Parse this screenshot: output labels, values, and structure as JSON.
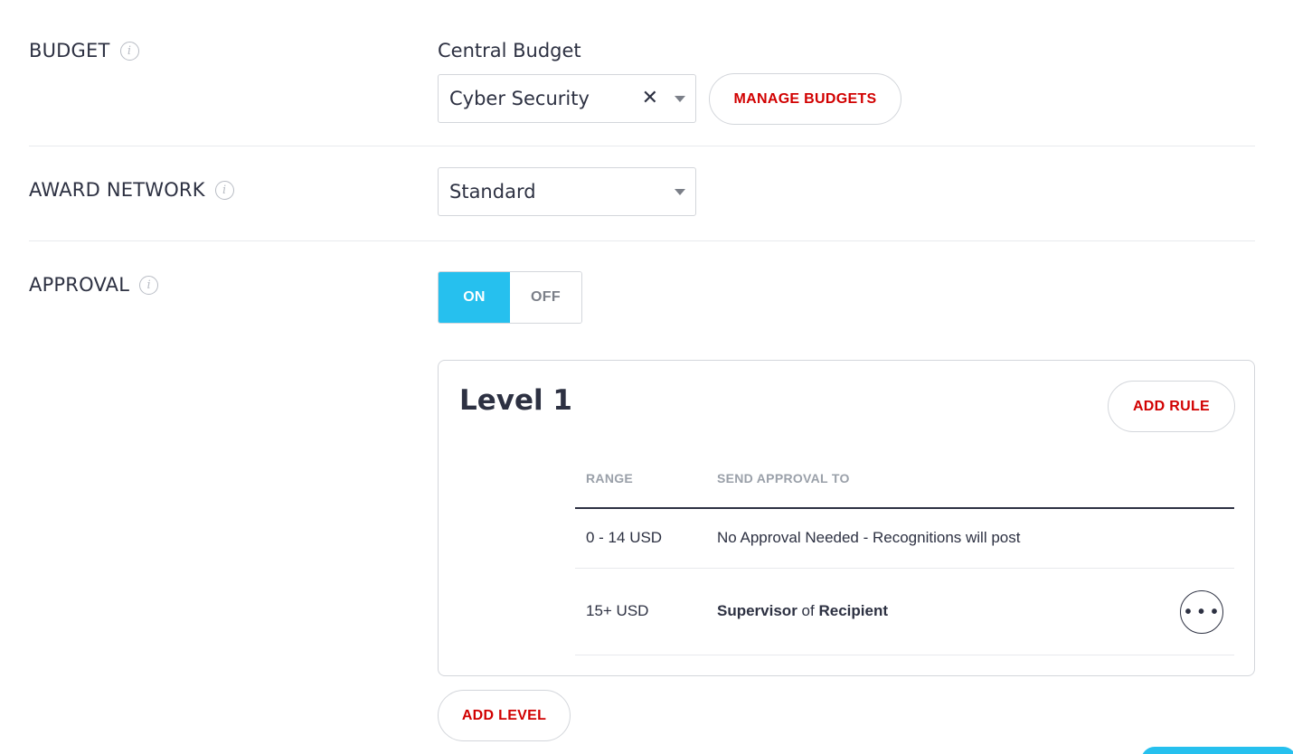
{
  "budget": {
    "label": "BUDGET",
    "caption": "Central Budget",
    "selected": "Cyber Security",
    "clear_glyph": "✕",
    "manage_label": "MANAGE BUDGETS"
  },
  "award_network": {
    "label": "AWARD NETWORK",
    "selected": "Standard"
  },
  "approval": {
    "label": "APPROVAL",
    "on_label": "ON",
    "off_label": "OFF",
    "state": "on"
  },
  "level": {
    "title": "Level 1",
    "add_rule_label": "ADD RULE",
    "columns": [
      "RANGE",
      "SEND APPROVAL TO"
    ],
    "rows": [
      {
        "range": "0 - 14 USD",
        "approval": "No Approval Needed - Recognitions will post"
      },
      {
        "range": "15+ USD",
        "approver": "Supervisor",
        "connector": "of",
        "subject": "Recipient"
      }
    ],
    "more_glyph": "• • •"
  },
  "add_level_label": "ADD LEVEL",
  "info_glyph": "i",
  "colors": {
    "accent": "#26c0ee",
    "danger": "#d10000",
    "text": "#2d3142"
  },
  "icons": [
    "info-icon",
    "clear-icon",
    "caret-down-icon",
    "more-icon"
  ]
}
